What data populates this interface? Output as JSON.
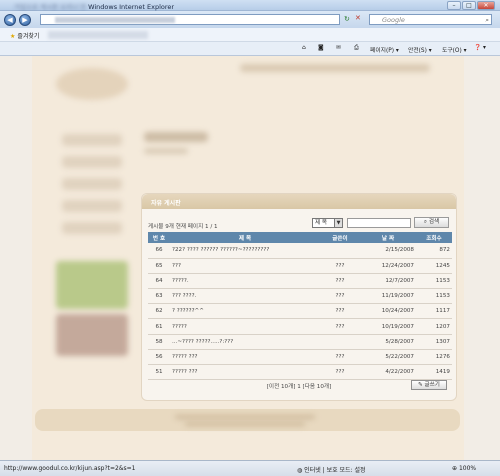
{
  "window": {
    "title": "Windows Internet Explorer",
    "minimize": "–",
    "maximize": "□",
    "close": "✕"
  },
  "address": {
    "back": "◀",
    "forward": "▶",
    "search_placeholder": "Google"
  },
  "favorites": {
    "label": "즐겨찾기"
  },
  "commands": {
    "page": "페이지(P) ▾",
    "safety": "안전(S) ▾",
    "tools": "도구(O) ▾",
    "help": "❓ ▾"
  },
  "board": {
    "title": "자유 게시판",
    "info": "게시물 9개    현재 페이지 1 / 1",
    "select_value": "제 목",
    "search_button": "검색",
    "columns": [
      "번 호",
      "제 목",
      "글쓴이",
      "날 짜",
      "조회수"
    ],
    "rows": [
      [
        "66",
        "?22? ???? ?????? ??????~?????????",
        "",
        "2/15/2008",
        "872"
      ],
      [
        "65",
        "???",
        "???",
        "12/24/2007",
        "1245"
      ],
      [
        "64",
        "?????.",
        "???",
        "12/7/2007",
        "1153"
      ],
      [
        "63",
        "??? ????.",
        "???",
        "11/19/2007",
        "1153"
      ],
      [
        "62",
        "? ??????^^",
        "???",
        "10/24/2007",
        "1117"
      ],
      [
        "61",
        "?????",
        "???",
        "10/19/2007",
        "1207"
      ],
      [
        "58",
        "...~???? ?????.....?:???",
        "",
        "5/28/2007",
        "1307"
      ],
      [
        "56",
        "????? ???",
        "???",
        "5/22/2007",
        "1276"
      ],
      [
        "51",
        "????? ???",
        "???",
        "4/22/2007",
        "1419"
      ]
    ],
    "pager": "[이전 10개] 1 [다음 10개]",
    "write_button": "글쓰기"
  },
  "status": {
    "url": "http://www.goodul.co.kr/kijun.asp?t=2&s=1",
    "zone": "인터넷 | 보호 모드: 설정",
    "zoom": "100%"
  }
}
